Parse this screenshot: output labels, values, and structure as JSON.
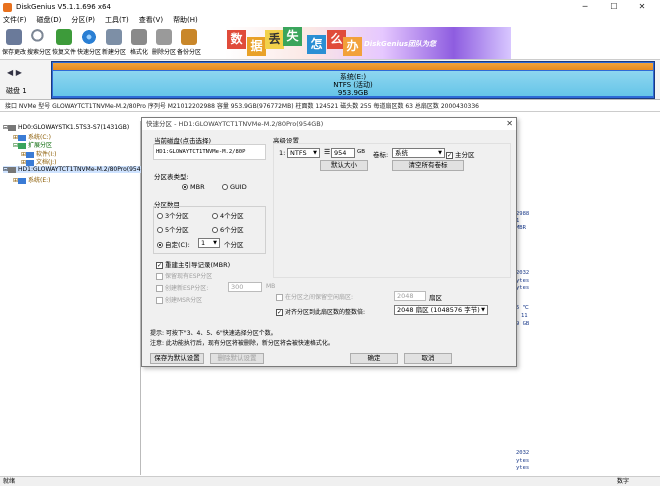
{
  "window": {
    "title": "DiskGenius V5.1.1.696 x64",
    "minimize": "─",
    "maximize": "☐",
    "close": "✕"
  },
  "menu": [
    "文件(F)",
    "磁盘(D)",
    "分区(P)",
    "工具(T)",
    "查看(V)",
    "帮助(H)"
  ],
  "toolbar": {
    "buttons": [
      {
        "label": "保存更改",
        "icon": "save-icon",
        "color": "#6a7a9a"
      },
      {
        "label": "搜索分区",
        "icon": "search-icon",
        "color": "#9aa4b2"
      },
      {
        "label": "恢复文件",
        "icon": "recover-icon",
        "color": "#3d9b3a"
      },
      {
        "label": "快速分区",
        "icon": "quick-partition-icon",
        "color": "#2a7fd4"
      },
      {
        "label": "新建分区",
        "icon": "new-partition-icon",
        "color": "#7d8fa6"
      },
      {
        "label": "格式化",
        "icon": "format-icon",
        "color": "#8a8a8a"
      },
      {
        "label": "删除分区",
        "icon": "delete-icon",
        "color": "#9a9a9a"
      },
      {
        "label": "备份分区",
        "icon": "backup-icon",
        "color": "#c9872a"
      }
    ]
  },
  "banner": {
    "chars": [
      "数",
      "据",
      "丢",
      "失",
      "怎",
      "么",
      "办"
    ],
    "brand": "DiskGenius团队为您"
  },
  "disk": {
    "nav_left": "◀",
    "nav_right": "▶",
    "label": "磁盘 1",
    "partition_name": "系统(E:)",
    "partition_fs": "NTFS (活动)",
    "partition_size": "953.9GB"
  },
  "infoline": "接口 NVMe  型号 GLOWAYTCT1TNVMe-M.2/80Pro  序列号 M21012202988  容量 953.9GB(976772MB)  柱面数 124521  磁头数 255  每道扇区数 63  总扇区数 2000430336",
  "tree": {
    "items": [
      {
        "text": "HD0:GLOWAYSTK1.5TS3-S7(1431GB)",
        "color": "#000"
      },
      {
        "text": "系统(C:)",
        "color": "#8a5a00"
      },
      {
        "text": "扩展分区",
        "color": "#0a6a0a"
      },
      {
        "text": "软件(I:)",
        "color": "#8a5a00"
      },
      {
        "text": "文档(J:)",
        "color": "#8a5a00"
      },
      {
        "text": "HD1:GLOWAYTCT1TNVMe-M.2/80Pro(954",
        "color": "#000"
      },
      {
        "text": "系统(E:)",
        "color": "#8a5a00"
      }
    ]
  },
  "right_fragments": [
    "2988",
    "1",
    "MBR",
    "2032",
    "ytes",
    "ytes",
    "5 ℃",
    "11",
    "9 GB",
    "2032",
    "ytes",
    "ytes"
  ],
  "dialog": {
    "title": "快速分区 - HD1:GLOWAYTCT1TNVMe-M.2/80Pro(954GB)",
    "close": "✕",
    "current_disk_label": "当前磁盘(点击选择)",
    "current_disk_value": "HD1:GLOWAYTCT1TNVMe-M.2/80P",
    "table_type_label": "分区表类型:",
    "mbr": "MBR",
    "guid": "GUID",
    "count_label": "分区数目",
    "counts": [
      "3个分区",
      "4个分区",
      "5个分区",
      "6个分区"
    ],
    "custom_label": "自定(C):",
    "custom_value": "1",
    "custom_unit": "个分区",
    "rebuild_mbr": "重建主引导记录(MBR)",
    "keep_esp": "保留现有ESP分区",
    "create_esp": "创建新ESP分区:",
    "esp_size": "300",
    "esp_unit": "MB",
    "create_msr": "创建MSR分区",
    "advanced_label": "高级设置",
    "row_index": "1:",
    "fs_value": "NTFS",
    "size_value": "954",
    "size_unit": "GB",
    "volume_label": "卷标:",
    "volume_value": "系统",
    "primary_label": "主分区",
    "default_size_btn": "默认大小",
    "clear_labels_btn": "清空所有卷标",
    "reserve_label": "在分区之间保留空闲扇区:",
    "reserve_value": "2048",
    "reserve_unit": "扇区",
    "align_label": "对齐分区到此扇区数的整数倍:",
    "align_value": "2048 扇区 (1048576 字节)",
    "hint": "提示: 可按下\"3、4、5、6\"快速选择分区个数。",
    "note": "注意: 此功能执行后，现有分区将被删除，新分区将会被快速格式化。",
    "save_default_btn": "保存为默认设置",
    "delete_default_btn": "删除默认设置",
    "ok_btn": "确定",
    "cancel_btn": "取消"
  },
  "status": {
    "ready": "就绪",
    "numlock": "数字"
  }
}
